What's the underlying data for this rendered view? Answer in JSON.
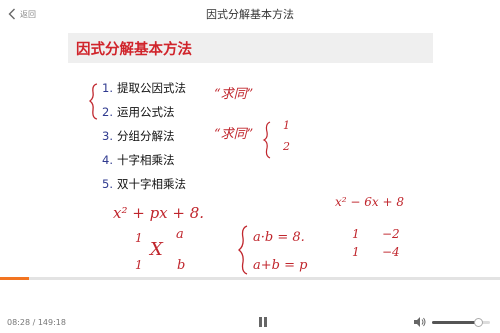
{
  "header": {
    "back_label": "返回",
    "title": "因式分解基本方法"
  },
  "slide": {
    "title": "因式分解基本方法",
    "methods": [
      {
        "num": "1.",
        "label": "提取公因式法"
      },
      {
        "num": "2.",
        "label": "运用公式法"
      },
      {
        "num": "3.",
        "label": "分组分解法"
      },
      {
        "num": "4.",
        "label": "十字相乘法"
      },
      {
        "num": "5.",
        "label": "双十字相乘法"
      }
    ],
    "annotations": {
      "note_top": "“求同”",
      "note_mid": "“求同”",
      "brace_nums": [
        "1",
        "2"
      ],
      "expr_left": "x² + px + 8.",
      "cross_top_left": "1",
      "cross_x": "X",
      "cross_top_right": "a",
      "cross_bottom_left": "1",
      "cross_bottom_right": "b",
      "system_line1": "a·b = 8.",
      "system_line2": "a+b = p",
      "expr_right": "x² − 6x + 8",
      "right_row1_left": "1",
      "right_row1_right": "−2",
      "right_row2_left": "1",
      "right_row2_right": "−4"
    }
  },
  "player": {
    "time": "08:28 / 149:18",
    "progress": 0.057,
    "volume": 0.8,
    "colors": {
      "accent": "#f27421",
      "title_red": "#d0242b",
      "number_blue": "#2f3a8f"
    }
  }
}
